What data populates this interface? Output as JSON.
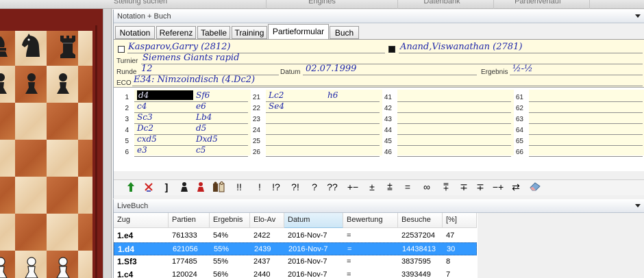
{
  "top_toolbar": [
    "Stellung suchen",
    "Engines",
    "Datenbank",
    "Partienverlauf"
  ],
  "notation_panel": {
    "title": "Notation + Buch",
    "tabs": [
      "Notation",
      "Referenz",
      "Tabelle",
      "Training",
      "Partieformular",
      "Buch"
    ],
    "active_tab": "Partieformular"
  },
  "form": {
    "white_player": "Kasparov,Garry (2812)",
    "black_player": "Anand,Viswanathan (2781)",
    "tournament_label": "Turnier",
    "tournament": "Siemens Giants rapid",
    "round_label": "Runde",
    "round": "12",
    "date_label": "Datum",
    "date": "02.07.1999",
    "result_label": "Ergebnis",
    "result": "½-½",
    "eco_label": "ECO",
    "eco": "E34: Nimzoindisch (4.Dc2)"
  },
  "moves": [
    {
      "n": "1",
      "w": "d4",
      "b": "Sf6"
    },
    {
      "n": "2",
      "w": "c4",
      "b": "e6"
    },
    {
      "n": "3",
      "w": "Sc3",
      "b": "Lb4"
    },
    {
      "n": "4",
      "w": "Dc2",
      "b": "d5"
    },
    {
      "n": "5",
      "w": "cxd5",
      "b": "Dxd5"
    },
    {
      "n": "6",
      "w": "e3",
      "b": "c5"
    },
    {
      "n": "21",
      "w": "Lc2",
      "b": "h6"
    },
    {
      "n": "22",
      "w": "Se4",
      "b": ""
    },
    {
      "n": "23",
      "w": "",
      "b": ""
    },
    {
      "n": "24",
      "w": "",
      "b": ""
    },
    {
      "n": "25",
      "w": "",
      "b": ""
    },
    {
      "n": "26",
      "w": "",
      "b": ""
    },
    {
      "n": "41",
      "w": "",
      "b": ""
    },
    {
      "n": "42",
      "w": "",
      "b": ""
    },
    {
      "n": "43",
      "w": "",
      "b": ""
    },
    {
      "n": "44",
      "w": "",
      "b": ""
    },
    {
      "n": "45",
      "w": "",
      "b": ""
    },
    {
      "n": "46",
      "w": "",
      "b": ""
    },
    {
      "n": "61",
      "w": "",
      "b": ""
    },
    {
      "n": "62",
      "w": "",
      "b": ""
    },
    {
      "n": "63",
      "w": "",
      "b": ""
    },
    {
      "n": "64",
      "w": "",
      "b": ""
    },
    {
      "n": "65",
      "w": "",
      "b": ""
    },
    {
      "n": "66",
      "w": "",
      "b": ""
    }
  ],
  "symbols": [
    {
      "icon": "green-up-arrow-icon",
      "label": ""
    },
    {
      "icon": "delete-move-icon",
      "label": ""
    },
    {
      "icon": "bracket-icon",
      "label": "]"
    },
    {
      "icon": "black-pawn-icon",
      "label": ""
    },
    {
      "icon": "red-pawn-icon",
      "label": ""
    },
    {
      "icon": "pieces-icon",
      "label": ""
    },
    {
      "icon": "",
      "label": "!!"
    },
    {
      "icon": "",
      "label": "!"
    },
    {
      "icon": "",
      "label": "!?"
    },
    {
      "icon": "",
      "label": "?!"
    },
    {
      "icon": "",
      "label": "?"
    },
    {
      "icon": "",
      "label": "??"
    },
    {
      "icon": "",
      "label": "+−"
    },
    {
      "icon": "",
      "label": "±"
    },
    {
      "icon": "",
      "label": "⩲"
    },
    {
      "icon": "",
      "label": "="
    },
    {
      "icon": "",
      "label": "∞"
    },
    {
      "icon": "",
      "label": "⩱"
    },
    {
      "icon": "",
      "label": "∓"
    },
    {
      "icon": "",
      "label": "∓"
    },
    {
      "icon": "",
      "label": "−+"
    },
    {
      "icon": "",
      "label": "⇄"
    },
    {
      "icon": "eraser-icon",
      "label": ""
    }
  ],
  "livebuch": {
    "title": "LiveBuch",
    "columns": [
      "Zug",
      "Partien",
      "Ergebnis",
      "Elo-Av",
      "Datum",
      "Bewertung",
      "Besuche",
      "[%]"
    ],
    "sorted_column": "Datum",
    "rows": [
      {
        "zug": "1.e4",
        "partien": "761333",
        "ergebnis": "54%",
        "elo": "2422",
        "datum": "2016-Nov-7",
        "bewertung": "=",
        "besuche": "22537204",
        "pct": "47"
      },
      {
        "zug": "1.d4",
        "partien": "621056",
        "ergebnis": "55%",
        "elo": "2439",
        "datum": "2016-Nov-7",
        "bewertung": "=",
        "besuche": "14438413",
        "pct": "30"
      },
      {
        "zug": "1.Sf3",
        "partien": "177485",
        "ergebnis": "55%",
        "elo": "2437",
        "datum": "2016-Nov-7",
        "bewertung": "=",
        "besuche": "3837595",
        "pct": "8"
      },
      {
        "zug": "1.c4",
        "partien": "120024",
        "ergebnis": "56%",
        "elo": "2440",
        "datum": "2016-Nov-7",
        "bewertung": "=",
        "besuche": "3393449",
        "pct": "7"
      }
    ],
    "selected_row": 1
  },
  "colors": {
    "handwriting": "#1c24a8",
    "form_background": "#fffbe0",
    "selection": "#3399ff",
    "board_light": "#f1dbb8",
    "board_dark": "#b35a2b",
    "board_frame": "#7a1e17"
  }
}
